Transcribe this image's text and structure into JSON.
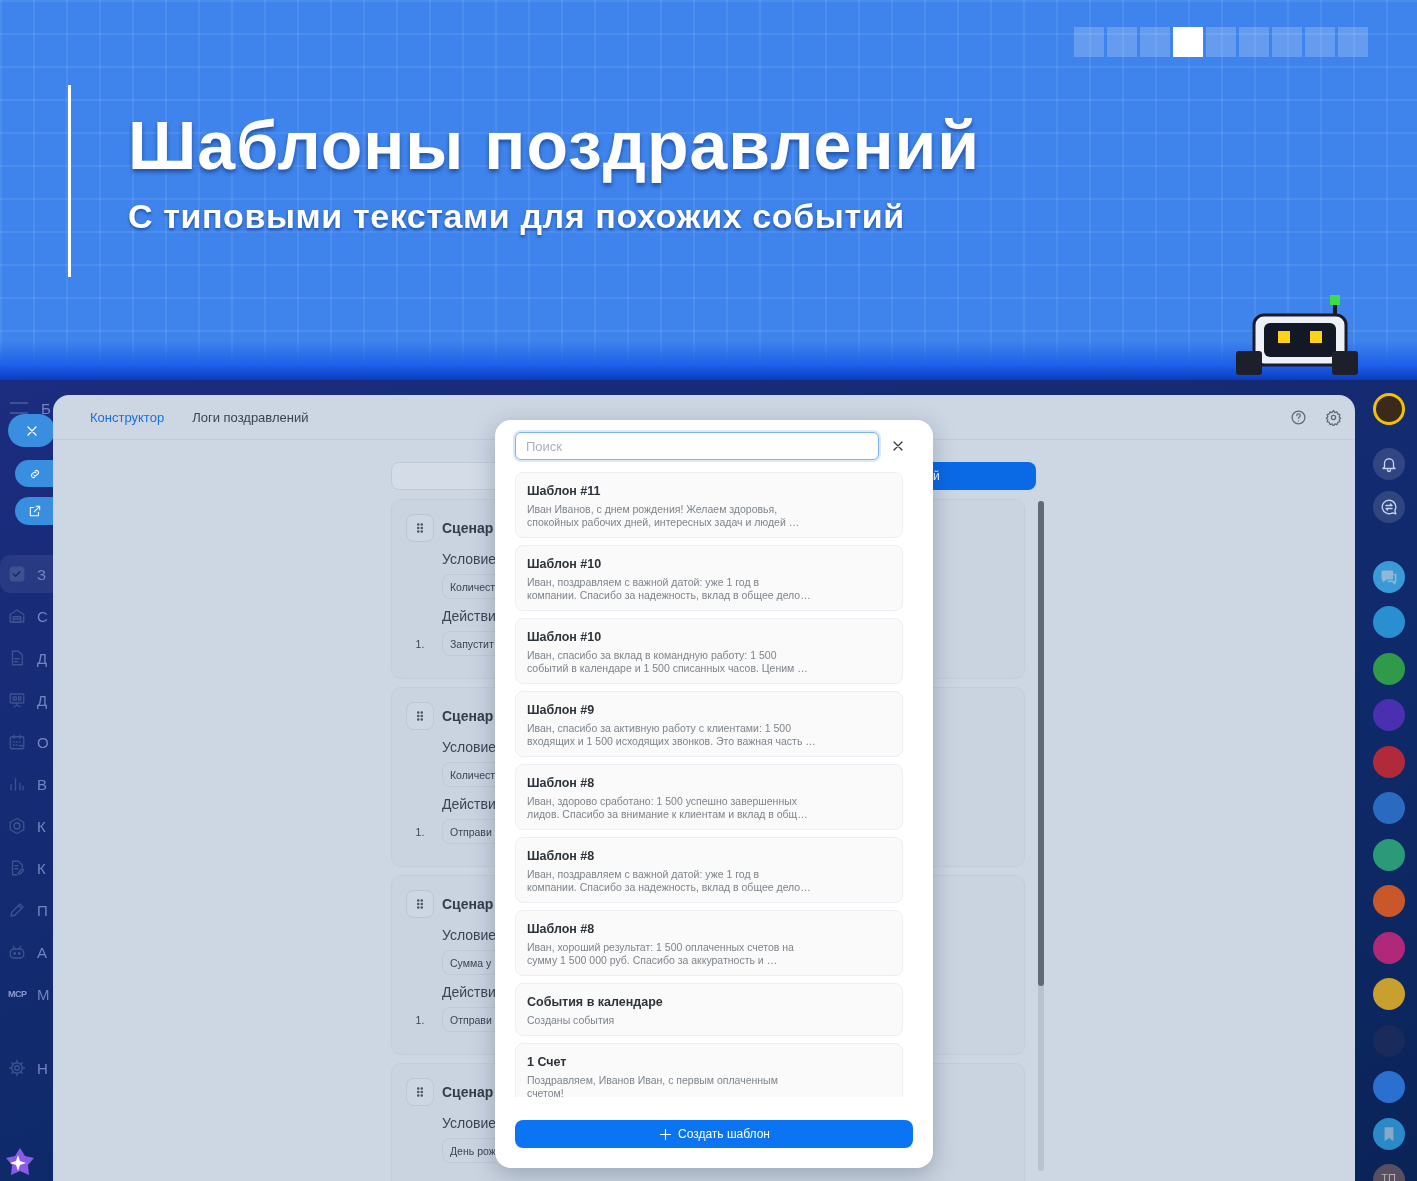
{
  "banner": {
    "title": "Шаблоны поздравлений",
    "subtitle": "С типовыми текстами для похожих событий",
    "pager": [
      {
        "selected": false
      },
      {
        "selected": false
      },
      {
        "selected": false
      },
      {
        "selected": true
      },
      {
        "selected": false
      },
      {
        "selected": false
      },
      {
        "selected": false
      },
      {
        "selected": false
      },
      {
        "selected": false
      }
    ]
  },
  "left_sidebar": {
    "header": "Б",
    "items": [
      {
        "kind": "check",
        "label": "З",
        "selected": true
      },
      {
        "kind": "building",
        "label": "С",
        "selected": false
      },
      {
        "kind": "document",
        "label": "Д",
        "selected": false
      },
      {
        "kind": "board",
        "label": "Д",
        "selected": false
      },
      {
        "kind": "calendar",
        "label": "О",
        "selected": false
      },
      {
        "kind": "chart",
        "label": "В",
        "selected": false
      },
      {
        "kind": "hexagon",
        "label": "К",
        "selected": false
      },
      {
        "kind": "edit",
        "label": "К",
        "selected": false
      },
      {
        "kind": "pen",
        "label": "П",
        "selected": false
      },
      {
        "kind": "robot",
        "label": "А",
        "selected": false
      },
      {
        "kind": "mcp",
        "icon_text": "MCP",
        "label": "М",
        "selected": false
      },
      {
        "kind": "gear",
        "label": "Н",
        "selected": false
      }
    ]
  },
  "tabs": [
    {
      "label": "Конструктор",
      "selected": true
    },
    {
      "label": "Логи поздравлений",
      "selected": false
    }
  ],
  "toolbar": {
    "button_label": "й"
  },
  "scenarios": [
    {
      "title": "Сценар",
      "condition_label": "Условие",
      "condition": "Количест",
      "actions_label": "Действи",
      "action_number": "1.",
      "action": "Запустит"
    },
    {
      "title": "Сценар",
      "condition_label": "Условие",
      "condition": "Количест",
      "actions_label": "Действи",
      "action_number": "1.",
      "action": "Отправи"
    },
    {
      "title": "Сценар",
      "condition_label": "Условие",
      "condition": "Сумма у",
      "actions_label": "Действи",
      "action_number": "1.",
      "action": "Отправи"
    },
    {
      "title": "Сценар",
      "condition_label": "Условие",
      "condition": "День рож"
    }
  ],
  "template_picker": {
    "search": {
      "placeholder": "Поиск"
    },
    "templates": [
      {
        "title": "Шаблон #11",
        "text": "Иван Иванов, с днем рождения! Желаем здоровья,\nспокойных рабочих дней, интересных задач и людей …"
      },
      {
        "title": "Шаблон #10",
        "text": "Иван, поздравляем с важной датой: уже 1 год в\nкомпании. Спасибо за надежность, вклад в общее дело…"
      },
      {
        "title": "Шаблон #10",
        "text": "Иван, спасибо за вклад в командную работу: 1 500\nсобытий в календаре и 1 500 списанных часов. Ценим …"
      },
      {
        "title": "Шаблон #9",
        "text": "Иван, спасибо за активную работу с клиентами: 1 500\nвходящих и 1 500 исходящих звонков. Это важная часть …"
      },
      {
        "title": "Шаблон #8",
        "text": "Иван, здорово сработано: 1 500 успешно завершенных\nлидов. Спасибо за внимание к клиентам и вклад в общ…"
      },
      {
        "title": "Шаблон #8",
        "text": "Иван, поздравляем с важной датой: уже 1 год в\nкомпании. Спасибо за надежность, вклад в общее дело…"
      },
      {
        "title": "Шаблон #8",
        "text": "Иван, хороший результат: 1 500 оплаченных счетов на\nсумму 1 500 000 руб. Спасибо за аккуратность и …"
      },
      {
        "title": "События в календаре",
        "text": "Созданы события"
      },
      {
        "title": "1 Счет",
        "text": "Поздравляем, Иванов Иван, с первым оплаченным\nсчетом!"
      }
    ],
    "create_button": "Создать шаблон"
  },
  "right_sidebar": {
    "avatars": [
      {
        "color": "#2a8fd0"
      },
      {
        "color": "#2f9a4a"
      },
      {
        "color": "#4a2fb0"
      },
      {
        "color": "#b02a3a"
      },
      {
        "color": "#2a6ac0"
      },
      {
        "color": "#2a9a78"
      },
      {
        "color": "#c8582a"
      },
      {
        "color": "#b0287a"
      },
      {
        "color": "#c8a030"
      },
      {
        "color": "#1a2a5a"
      },
      {
        "color": "#2a70d0"
      }
    ],
    "user_initials": "ТП"
  }
}
